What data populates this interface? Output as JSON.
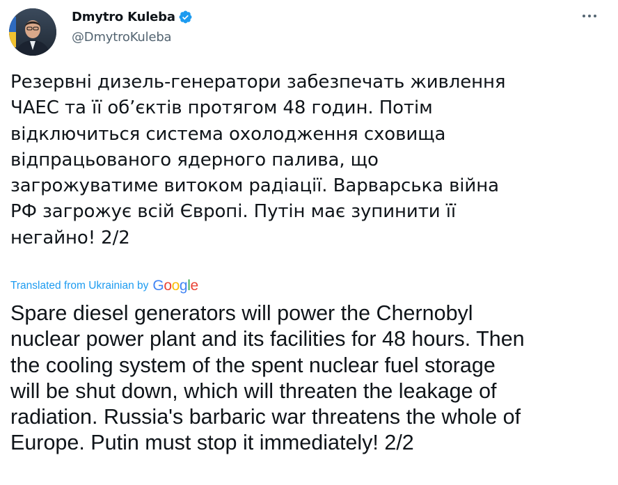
{
  "author": {
    "display_name": "Dmytro Kuleba",
    "handle": "@DmytroKuleba",
    "verified": true
  },
  "icons": {
    "verified": "verified-badge-icon",
    "more": "more-options-icon",
    "avatar": "avatar-photo"
  },
  "tweet": {
    "original_text": "Резервні дизель-генератори забезпечать живлення\nЧАЕС та її об’єктів протягом 48 годин. Потім\nвідключиться система охолодження сховища\nвідпрацьованого ядерного палива, що\nзагрожуватиме витоком радіації. Варварська війна\nРФ загрожує всій Європі. Путін має зупинити її\nнегайно! 2/2",
    "translation_label": "Translated from Ukrainian by",
    "translation_provider_letters": [
      "G",
      "o",
      "o",
      "g",
      "l",
      "e"
    ],
    "translated_text": "Spare diesel generators will power the Chernobyl\nnuclear power plant and its facilities for 48 hours. Then\nthe cooling system of the spent nuclear fuel storage\nwill be shut down, which will threaten the leakage of\nradiation. Russia's barbaric war threatens the whole of\nEurope. Putin must stop it immediately! 2/2"
  },
  "colors": {
    "text": "#0f1419",
    "secondary_text": "#536471",
    "link_blue": "#1d9bf0",
    "verified_blue": "#1d9bf0",
    "google_blue": "#4285f4",
    "google_red": "#ea4335",
    "google_yellow": "#fbbc05",
    "google_green": "#34a853"
  }
}
